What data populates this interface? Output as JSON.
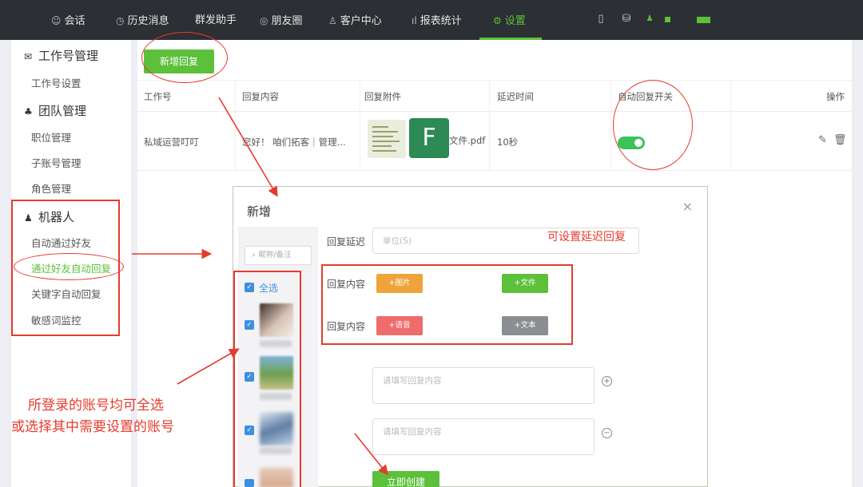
{
  "nav": {
    "tabs": [
      {
        "label": "会话",
        "icon": "chat-icon"
      },
      {
        "label": "历史消息",
        "icon": "clock-icon"
      },
      {
        "label": "群发助手",
        "icon": ""
      },
      {
        "label": "朋友圈",
        "icon": "moments-icon"
      },
      {
        "label": "客户中心",
        "icon": "user-icon"
      },
      {
        "label": "报表统计",
        "icon": "bar-chart-icon"
      },
      {
        "label": "设置",
        "icon": "gear-icon",
        "active": true
      }
    ]
  },
  "sidebar": {
    "groups": [
      {
        "title": "工作号管理",
        "icon": "wechat-icon",
        "items": [
          "工作号设置"
        ]
      },
      {
        "title": "团队管理",
        "icon": "team-icon",
        "items": [
          "职位管理",
          "子账号管理",
          "角色管理"
        ]
      },
      {
        "title": "机器人",
        "icon": "robot-icon",
        "items": [
          "自动通过好友",
          "通过好友自动回复",
          "关键字自动回复",
          "敏感词监控"
        ]
      }
    ],
    "active_item": "通过好友自动回复"
  },
  "main": {
    "add_button": "新增回复",
    "columns": [
      "工作号",
      "回复内容",
      "回复附件",
      "延迟时间",
      "自动回复开关",
      "操作"
    ],
    "rows": [
      {
        "account": "私域运营叮叮",
        "content": "您好！ 咱们拓客｜管理...",
        "attachment": "文件.pdf",
        "attachment_icon_letter": "F",
        "delay": "10秒",
        "auto_reply_on": true
      }
    ]
  },
  "modal": {
    "title": "新增",
    "close": "×",
    "search_placeholder": "昵称/备注",
    "select_all": "全选",
    "delay_label": "回复延迟",
    "delay_placeholder": "单位(S)",
    "content_label": "回复内容",
    "buttons": {
      "image": "+图片",
      "file": "+文件",
      "voice": "+语音",
      "text": "+文本"
    },
    "textarea_placeholder": "请填写回复内容",
    "add_symbol": "+",
    "remove_symbol": "−",
    "create_button": "立即创建"
  },
  "annotations": {
    "delay_note": "可设置延迟回复",
    "select_note_line1": "所登录的账号均可全选",
    "select_note_line2": "或选择其中需要设置的账号"
  },
  "colors": {
    "brand_green": "#5cc03a",
    "annotation_red": "#e53b2d",
    "image_orange": "#eea43a",
    "voice_red": "#ef6c6c",
    "text_gray": "#8a8d91",
    "checkbox_blue": "#3d8fe0"
  }
}
